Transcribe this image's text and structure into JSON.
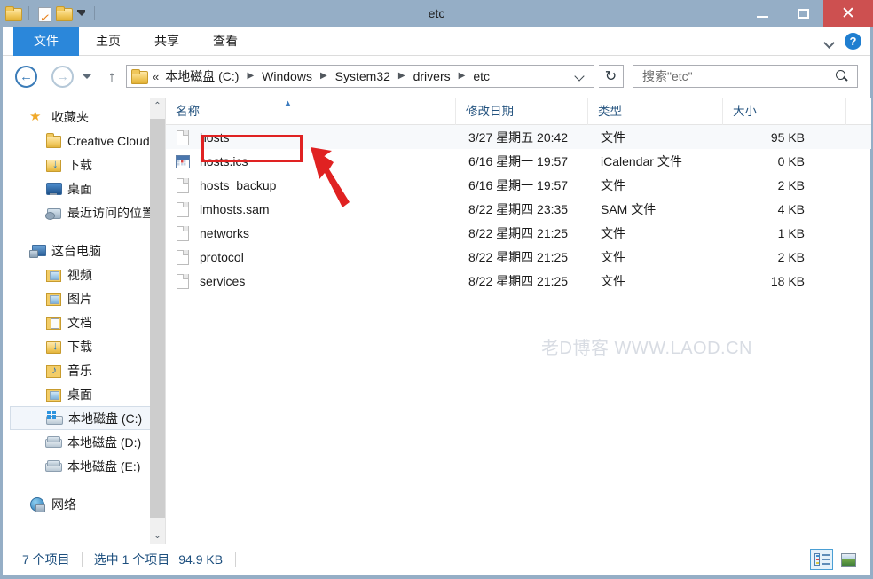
{
  "window": {
    "title": "etc",
    "minimize_label": "最小化",
    "maximize_label": "最大化",
    "close_label": "关闭",
    "close_glyph": "✕"
  },
  "quick_access": {
    "items": [
      {
        "name": "folder-icon",
        "label": "文件夹"
      },
      {
        "name": "properties-icon",
        "label": "属性"
      },
      {
        "name": "new-folder-icon",
        "label": "新建文件夹"
      },
      {
        "name": "customize-caret-icon",
        "label": "自定义快速访问工具栏"
      }
    ]
  },
  "ribbon": {
    "tabs": [
      {
        "label": "文件",
        "active": true
      },
      {
        "label": "主页",
        "active": false
      },
      {
        "label": "共享",
        "active": false
      },
      {
        "label": "查看",
        "active": false
      }
    ],
    "collapse_label": "展开功能区",
    "help_label": "?"
  },
  "addressbar": {
    "back_glyph": "←",
    "forward_glyph": "→",
    "recent_label": "最近浏览的位置",
    "up_glyph": "↑",
    "overflow": "«",
    "crumbs": [
      "本地磁盘 (C:)",
      "Windows",
      "System32",
      "drivers",
      "etc"
    ],
    "crumb_separator": "▶",
    "refresh_glyph": "↻",
    "refresh_label": "刷新"
  },
  "search": {
    "placeholder": "搜索\"etc\"",
    "value": ""
  },
  "sidebar": {
    "groups": [
      {
        "header": {
          "label": "收藏夹",
          "icon": "star-icon"
        },
        "items": [
          {
            "label": "Creative Cloud 文件",
            "icon": "folder-icon"
          },
          {
            "label": "下载",
            "icon": "folder-download-icon"
          },
          {
            "label": "桌面",
            "icon": "desktop-icon"
          },
          {
            "label": "最近访问的位置",
            "icon": "recent-places-icon"
          }
        ]
      },
      {
        "header": {
          "label": "这台电脑",
          "icon": "this-pc-icon"
        },
        "items": [
          {
            "label": "视频",
            "icon": "folder-video-icon",
            "selected": false
          },
          {
            "label": "图片",
            "icon": "folder-pictures-icon",
            "selected": false
          },
          {
            "label": "文档",
            "icon": "folder-documents-icon",
            "selected": false
          },
          {
            "label": "下载",
            "icon": "folder-download-icon",
            "selected": false
          },
          {
            "label": "音乐",
            "icon": "folder-music-icon",
            "selected": false
          },
          {
            "label": "桌面",
            "icon": "folder-desktop-icon",
            "selected": false
          },
          {
            "label": "本地磁盘 (C:)",
            "icon": "drive-windows-icon",
            "selected": true
          },
          {
            "label": "本地磁盘 (D:)",
            "icon": "drive-icon",
            "selected": false
          },
          {
            "label": "本地磁盘 (E:)",
            "icon": "drive-icon",
            "selected": false
          }
        ]
      },
      {
        "header": {
          "label": "网络",
          "icon": "network-icon"
        },
        "items": []
      }
    ],
    "scrollbar": {
      "up_glyph": "⌃",
      "down_glyph": "⌄"
    }
  },
  "filelist": {
    "columns": [
      {
        "label": "名称",
        "key": "name"
      },
      {
        "label": "修改日期",
        "key": "date"
      },
      {
        "label": "类型",
        "key": "type"
      },
      {
        "label": "大小",
        "key": "size"
      }
    ],
    "sort_glyph": "▲",
    "rows": [
      {
        "name": "hosts",
        "date": "3/27 星期五 20:42",
        "type": "文件",
        "size": "95 KB",
        "icon": "file-icon",
        "selected": true
      },
      {
        "name": "hosts.ics",
        "date": "6/16 星期一 19:57",
        "type": "iCalendar 文件",
        "size": "0 KB",
        "icon": "ics-file-icon",
        "selected": false
      },
      {
        "name": "hosts_backup",
        "date": "6/16 星期一 19:57",
        "type": "文件",
        "size": "2 KB",
        "icon": "file-icon",
        "selected": false
      },
      {
        "name": "lmhosts.sam",
        "date": "8/22 星期四 23:35",
        "type": "SAM 文件",
        "size": "4 KB",
        "icon": "file-icon",
        "selected": false
      },
      {
        "name": "networks",
        "date": "8/22 星期四 21:25",
        "type": "文件",
        "size": "1 KB",
        "icon": "file-icon",
        "selected": false
      },
      {
        "name": "protocol",
        "date": "8/22 星期四 21:25",
        "type": "文件",
        "size": "2 KB",
        "icon": "file-icon",
        "selected": false
      },
      {
        "name": "services",
        "date": "8/22 星期四 21:25",
        "type": "文件",
        "size": "18 KB",
        "icon": "file-icon",
        "selected": false
      }
    ]
  },
  "watermark": {
    "text": "老D博客 WWW.LAOD.CN"
  },
  "annotations": {
    "highlight_color": "#e02222",
    "arrow_color": "#e02222",
    "target": "hosts"
  },
  "statusbar": {
    "item_count": "7 个项目",
    "selection": "选中 1 个项目",
    "selection_size": "94.9 KB",
    "views": [
      {
        "name": "details-view-button",
        "label": "详细信息",
        "active": true
      },
      {
        "name": "large-icons-view-button",
        "label": "大图标",
        "active": false
      }
    ]
  }
}
